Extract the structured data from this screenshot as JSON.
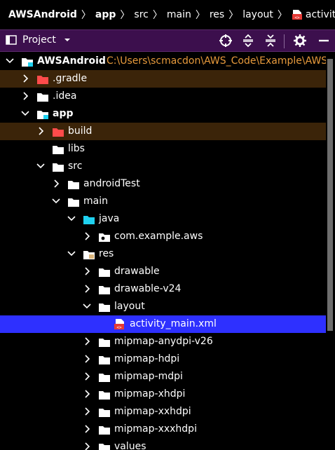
{
  "breadcrumb": {
    "items": [
      "AWSAndroid",
      "app",
      "src",
      "main",
      "res",
      "layout",
      "activity_main.xml"
    ]
  },
  "toolbar": {
    "project_label": "Project",
    "accent": "#3c0f4d"
  },
  "tree": {
    "root_label": "AWSAndroid",
    "root_path": "C:\\Users\\scmacdon\\AWS_Code\\Example\\AWSAndroid",
    "items": [
      {
        "label": "AWSAndroid",
        "level": 0,
        "chevron": "down",
        "icon": "module-folder"
      },
      {
        "label": ".gradle",
        "level": 1,
        "chevron": "right",
        "icon": "excluded-folder"
      },
      {
        "label": ".idea",
        "level": 1,
        "chevron": "right",
        "icon": "folder"
      },
      {
        "label": "app",
        "level": 1,
        "chevron": "down",
        "icon": "module-folder"
      },
      {
        "label": "build",
        "level": 2,
        "chevron": "right",
        "icon": "excluded-folder"
      },
      {
        "label": "libs",
        "level": 2,
        "chevron": "none",
        "icon": "folder"
      },
      {
        "label": "src",
        "level": 2,
        "chevron": "down",
        "icon": "folder"
      },
      {
        "label": "androidTest",
        "level": 3,
        "chevron": "right",
        "icon": "folder"
      },
      {
        "label": "main",
        "level": 3,
        "chevron": "down",
        "icon": "folder"
      },
      {
        "label": "java",
        "level": 4,
        "chevron": "down",
        "icon": "source-folder"
      },
      {
        "label": "com.example.aws",
        "level": 5,
        "chevron": "right",
        "icon": "package-folder"
      },
      {
        "label": "res",
        "level": 4,
        "chevron": "down",
        "icon": "resource-folder"
      },
      {
        "label": "drawable",
        "level": 5,
        "chevron": "right",
        "icon": "folder"
      },
      {
        "label": "drawable-v24",
        "level": 5,
        "chevron": "right",
        "icon": "folder"
      },
      {
        "label": "layout",
        "level": 5,
        "chevron": "down",
        "icon": "folder"
      },
      {
        "label": "activity_main.xml",
        "level": 6,
        "chevron": "none",
        "icon": "xml-file"
      },
      {
        "label": "mipmap-anydpi-v26",
        "level": 5,
        "chevron": "right",
        "icon": "folder"
      },
      {
        "label": "mipmap-hdpi",
        "level": 5,
        "chevron": "right",
        "icon": "folder"
      },
      {
        "label": "mipmap-mdpi",
        "level": 5,
        "chevron": "right",
        "icon": "folder"
      },
      {
        "label": "mipmap-xhdpi",
        "level": 5,
        "chevron": "right",
        "icon": "folder"
      },
      {
        "label": "mipmap-xxhdpi",
        "level": 5,
        "chevron": "right",
        "icon": "folder"
      },
      {
        "label": "mipmap-xxxhdpi",
        "level": 5,
        "chevron": "right",
        "icon": "folder"
      },
      {
        "label": "values",
        "level": 5,
        "chevron": "right",
        "icon": "folder"
      }
    ],
    "selected_index": 15,
    "excluded_color": "#3b2409",
    "selection_color": "#2e30ff",
    "path_color": "#e79a3c"
  }
}
